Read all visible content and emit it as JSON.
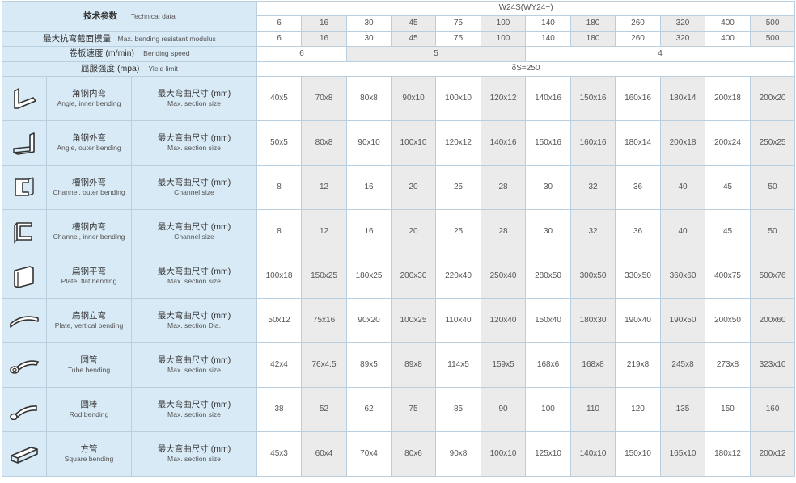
{
  "header": {
    "tech_zh": "技术参数",
    "tech_en": "Technical data",
    "model": "W24S(WY24−)",
    "modulus_zh": "最大抗弯截面模量",
    "modulus_en": "Max. bending resistant modulus",
    "speed_zh": "卷板速度 (m/min)",
    "speed_en": "Bending speed",
    "yield_zh": "屈服强度 (mpa)",
    "yield_en": "Yield limit",
    "yield_value": "δS=250"
  },
  "models": [
    "6",
    "16",
    "30",
    "45",
    "75",
    "100",
    "140",
    "180",
    "260",
    "320",
    "400",
    "500"
  ],
  "modulus": [
    "6",
    "16",
    "30",
    "45",
    "75",
    "100",
    "140",
    "180",
    "260",
    "320",
    "400",
    "500"
  ],
  "speeds": [
    "6",
    "5",
    "4"
  ],
  "rows": [
    {
      "icon": "angle-inner-icon",
      "name_zh": "角钢内弯",
      "name_en": "Angle, inner bending",
      "size_zh": "最大弯曲尺寸 (mm)",
      "size_en": "Max. section size",
      "values": [
        "40x5",
        "70x8",
        "80x8",
        "90x10",
        "100x10",
        "120x12",
        "140x16",
        "150x16",
        "160x16",
        "180x14",
        "200x18",
        "200x20"
      ]
    },
    {
      "icon": "angle-outer-icon",
      "name_zh": "角钢外弯",
      "name_en": "Angle, outer bending",
      "size_zh": "最大弯曲尺寸 (mm)",
      "size_en": "Max. section size",
      "values": [
        "50x5",
        "80x8",
        "90x10",
        "100x10",
        "120x12",
        "140x16",
        "150x16",
        "160x16",
        "180x14",
        "200x18",
        "200x24",
        "250x25"
      ]
    },
    {
      "icon": "channel-outer-icon",
      "name_zh": "槽钢外弯",
      "name_en": "Channel, outer bending",
      "size_zh": "最大弯曲尺寸 (mm)",
      "size_en": "Channel size",
      "values": [
        "8",
        "12",
        "16",
        "20",
        "25",
        "28",
        "30",
        "32",
        "36",
        "40",
        "45",
        "50"
      ]
    },
    {
      "icon": "channel-inner-icon",
      "name_zh": "槽钢内弯",
      "name_en": "Channel, inner bending",
      "size_zh": "最大弯曲尺寸 (mm)",
      "size_en": "Channel size",
      "values": [
        "8",
        "12",
        "16",
        "20",
        "25",
        "28",
        "30",
        "32",
        "36",
        "40",
        "45",
        "50"
      ]
    },
    {
      "icon": "plate-flat-icon",
      "name_zh": "扁钢平弯",
      "name_en": "Plate, flat bending",
      "size_zh": "最大弯曲尺寸 (mm)",
      "size_en": "Max. section size",
      "values": [
        "100x18",
        "150x25",
        "180x25",
        "200x30",
        "220x40",
        "250x40",
        "280x50",
        "300x50",
        "330x50",
        "360x60",
        "400x75",
        "500x76"
      ]
    },
    {
      "icon": "plate-vertical-icon",
      "name_zh": "扁钢立弯",
      "name_en": "Plate, vertical bending",
      "size_zh": "最大弯曲尺寸 (mm)",
      "size_en": "Max. section Dia.",
      "values": [
        "50x12",
        "75x16",
        "90x20",
        "100x25",
        "110x40",
        "120x40",
        "150x40",
        "180x30",
        "190x40",
        "190x50",
        "200x50",
        "200x60"
      ]
    },
    {
      "icon": "tube-icon",
      "name_zh": "圆管",
      "name_en": "Tube bending",
      "size_zh": "最大弯曲尺寸 (mm)",
      "size_en": "Max. section size",
      "values": [
        "42x4",
        "76x4.5",
        "89x5",
        "89x8",
        "114x5",
        "159x5",
        "168x6",
        "168x8",
        "219x8",
        "245x8",
        "273x8",
        "323x10"
      ]
    },
    {
      "icon": "rod-icon",
      "name_zh": "圆棒",
      "name_en": "Rod bending",
      "size_zh": "最大弯曲尺寸 (mm)",
      "size_en": "Max. section size",
      "values": [
        "38",
        "52",
        "62",
        "75",
        "85",
        "90",
        "100",
        "110",
        "120",
        "135",
        "150",
        "160"
      ]
    },
    {
      "icon": "square-tube-icon",
      "name_zh": "方管",
      "name_en": "Square bending",
      "size_zh": "最大弯曲尺寸 (mm)",
      "size_en": "Max. section size",
      "values": [
        "45x3",
        "60x4",
        "70x4",
        "80x6",
        "90x8",
        "100x10",
        "125x10",
        "140x10",
        "150x10",
        "165x10",
        "180x12",
        "200x12"
      ]
    }
  ]
}
